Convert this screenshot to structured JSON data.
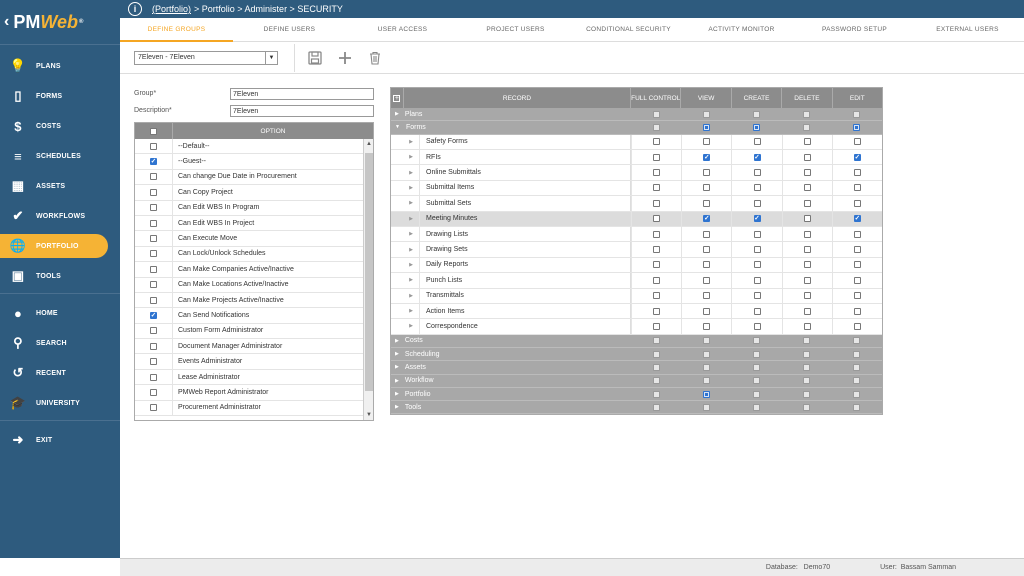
{
  "app": {
    "logo_text_pm": "PM",
    "logo_text_web": "Web",
    "logo_reg": "®"
  },
  "breadcrumb": {
    "link": "(Portfolio)",
    "rest": " > Portfolio > Administer > SECURITY"
  },
  "sidebar": {
    "items": [
      {
        "label": "PLANS",
        "icon": "lightbulb-icon"
      },
      {
        "label": "FORMS",
        "icon": "document-icon"
      },
      {
        "label": "COSTS",
        "icon": "dollar-icon"
      },
      {
        "label": "SCHEDULES",
        "icon": "schedule-bars-icon"
      },
      {
        "label": "ASSETS",
        "icon": "building-icon"
      },
      {
        "label": "WORKFLOWS",
        "icon": "checkmark-icon"
      },
      {
        "label": "PORTFOLIO",
        "icon": "globe-icon"
      },
      {
        "label": "TOOLS",
        "icon": "toolbox-icon"
      }
    ],
    "bottom": [
      {
        "label": "HOME",
        "icon": "home-avatar-icon"
      },
      {
        "label": "SEARCH",
        "icon": "search-icon"
      },
      {
        "label": "RECENT",
        "icon": "history-icon"
      },
      {
        "label": "UNIVERSITY",
        "icon": "graduation-cap-icon"
      }
    ],
    "exit": {
      "label": "EXIT",
      "icon": "exit-icon"
    }
  },
  "tabs": [
    "DEFINE GROUPS",
    "DEFINE USERS",
    "USER ACCESS",
    "PROJECT USERS",
    "CONDITIONAL SECURITY",
    "ACTIVITY MONITOR",
    "PASSWORD SETUP",
    "EXTERNAL USERS"
  ],
  "toolbar": {
    "selected_group": "7Eleven - 7Eleven"
  },
  "form": {
    "group_label": "Group*",
    "group_value": "7Eleven",
    "description_label": "Description*",
    "description_value": "7Eleven"
  },
  "options": {
    "header": "OPTION",
    "rows": [
      {
        "label": "--Default--",
        "checked": false
      },
      {
        "label": "--Guest--",
        "checked": true
      },
      {
        "label": "Can change Due Date in Procurement",
        "checked": false
      },
      {
        "label": "Can Copy Project",
        "checked": false
      },
      {
        "label": "Can Edit WBS In Program",
        "checked": false
      },
      {
        "label": "Can Edit WBS In Project",
        "checked": false
      },
      {
        "label": "Can Execute Move",
        "checked": false
      },
      {
        "label": "Can Lock/Unlock Schedules",
        "checked": false
      },
      {
        "label": "Can Make Companies Active/Inactive",
        "checked": false
      },
      {
        "label": "Can Make Locations Active/Inactive",
        "checked": false
      },
      {
        "label": "Can Make Projects Active/Inactive",
        "checked": false
      },
      {
        "label": "Can Send Notifications",
        "checked": true
      },
      {
        "label": "Custom Form Administrator",
        "checked": false
      },
      {
        "label": "Document Manager Administrator",
        "checked": false
      },
      {
        "label": "Events Administrator",
        "checked": false
      },
      {
        "label": "Lease Administrator",
        "checked": false
      },
      {
        "label": "PMWeb Report Administrator",
        "checked": false
      },
      {
        "label": "Procurement Administrator",
        "checked": false
      }
    ]
  },
  "records": {
    "headers": {
      "record": "RECORD",
      "cols": [
        "FULL CONTROL",
        "VIEW",
        "CREATE",
        "DELETE",
        "EDIT"
      ]
    },
    "rows": [
      {
        "type": "group",
        "label": "Plans",
        "expanded": false,
        "states": [
          "sq",
          "sq",
          "sq",
          "sq",
          "sq"
        ]
      },
      {
        "type": "group",
        "label": "Forms",
        "expanded": true,
        "states": [
          "sq",
          "sqb",
          "sqb",
          "sq",
          "sqb"
        ]
      },
      {
        "type": "child",
        "label": "Safety Forms",
        "states": [
          "off",
          "off",
          "off",
          "off",
          "off"
        ]
      },
      {
        "type": "child",
        "label": "RFIs",
        "states": [
          "off",
          "on",
          "on",
          "off",
          "on"
        ]
      },
      {
        "type": "child",
        "label": "Online Submittals",
        "states": [
          "off",
          "off",
          "off",
          "off",
          "off"
        ]
      },
      {
        "type": "child",
        "label": "Submittal Items",
        "states": [
          "off",
          "off",
          "off",
          "off",
          "off"
        ]
      },
      {
        "type": "child",
        "label": "Submittal Sets",
        "states": [
          "off",
          "off",
          "off",
          "off",
          "off"
        ]
      },
      {
        "type": "child",
        "label": "Meeting Minutes",
        "highlight": true,
        "states": [
          "off",
          "on",
          "on",
          "off",
          "on"
        ]
      },
      {
        "type": "child",
        "label": "Drawing Lists",
        "states": [
          "off",
          "off",
          "off",
          "off",
          "off"
        ]
      },
      {
        "type": "child",
        "label": "Drawing Sets",
        "states": [
          "off",
          "off",
          "off",
          "off",
          "off"
        ]
      },
      {
        "type": "child",
        "label": "Daily Reports",
        "states": [
          "off",
          "off",
          "off",
          "off",
          "off"
        ]
      },
      {
        "type": "child",
        "label": "Punch Lists",
        "states": [
          "off",
          "off",
          "off",
          "off",
          "off"
        ]
      },
      {
        "type": "child",
        "label": "Transmittals",
        "states": [
          "off",
          "off",
          "off",
          "off",
          "off"
        ]
      },
      {
        "type": "child",
        "label": "Action Items",
        "states": [
          "off",
          "off",
          "off",
          "off",
          "off"
        ]
      },
      {
        "type": "child",
        "label": "Correspondence",
        "states": [
          "off",
          "off",
          "off",
          "off",
          "off"
        ]
      },
      {
        "type": "group",
        "label": "Costs",
        "expanded": false,
        "states": [
          "sq",
          "sq",
          "sq",
          "sq",
          "sq"
        ]
      },
      {
        "type": "group",
        "label": "Scheduling",
        "expanded": false,
        "states": [
          "sq",
          "sq",
          "sq",
          "sq",
          "sq"
        ]
      },
      {
        "type": "group",
        "label": "Assets",
        "expanded": false,
        "states": [
          "sq",
          "sq",
          "sq",
          "sq",
          "sq"
        ]
      },
      {
        "type": "group",
        "label": "Workflow",
        "expanded": false,
        "states": [
          "sq",
          "sq",
          "sq",
          "sq",
          "sq"
        ]
      },
      {
        "type": "group",
        "label": "Portfolio",
        "expanded": false,
        "states": [
          "sq",
          "sqb",
          "sq",
          "sq",
          "sq"
        ]
      },
      {
        "type": "group",
        "label": "Tools",
        "expanded": false,
        "states": [
          "sq",
          "sq",
          "sq",
          "sq",
          "sq"
        ]
      }
    ]
  },
  "status": {
    "db_label": "Database:",
    "db_value": "Demo70",
    "user_label": "User:",
    "user_value": "Bassam Samman"
  }
}
